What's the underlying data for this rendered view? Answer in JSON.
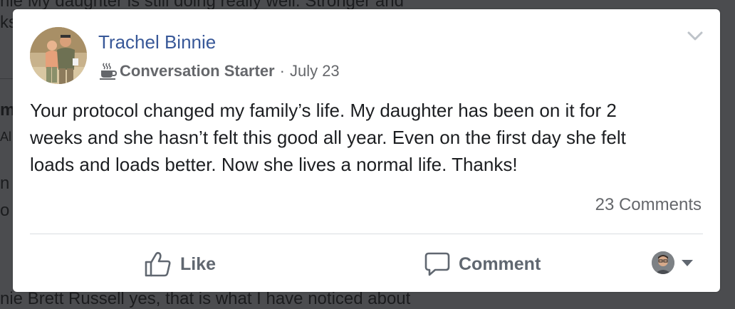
{
  "background": {
    "top_line": "nie My daughter is still doing really well. Stronger and",
    "top_line2": "ks",
    "side_fragments": [
      "m",
      "Al",
      "n",
      "o"
    ],
    "bottom_line": "nie Brett Russell yes, that is what I have noticed about"
  },
  "post": {
    "author": "Trachel Binnie",
    "badge_icon": "coffee-cup-icon",
    "badge_label": "Conversation Starter",
    "separator": "·",
    "date": "July 23",
    "text": "Your protocol changed my family’s life. My daughter has been on it for 2\nweeks and she hasn’t felt this good all year. Even on the first day she felt\nloads and loads better. Now she lives a normal life. Thanks!",
    "comments_count": "23 Comments",
    "actions": {
      "like_label": "Like",
      "comment_label": "Comment"
    },
    "colors": {
      "author": "#385898",
      "secondary_text": "#65676b",
      "action_text": "#606770"
    }
  }
}
